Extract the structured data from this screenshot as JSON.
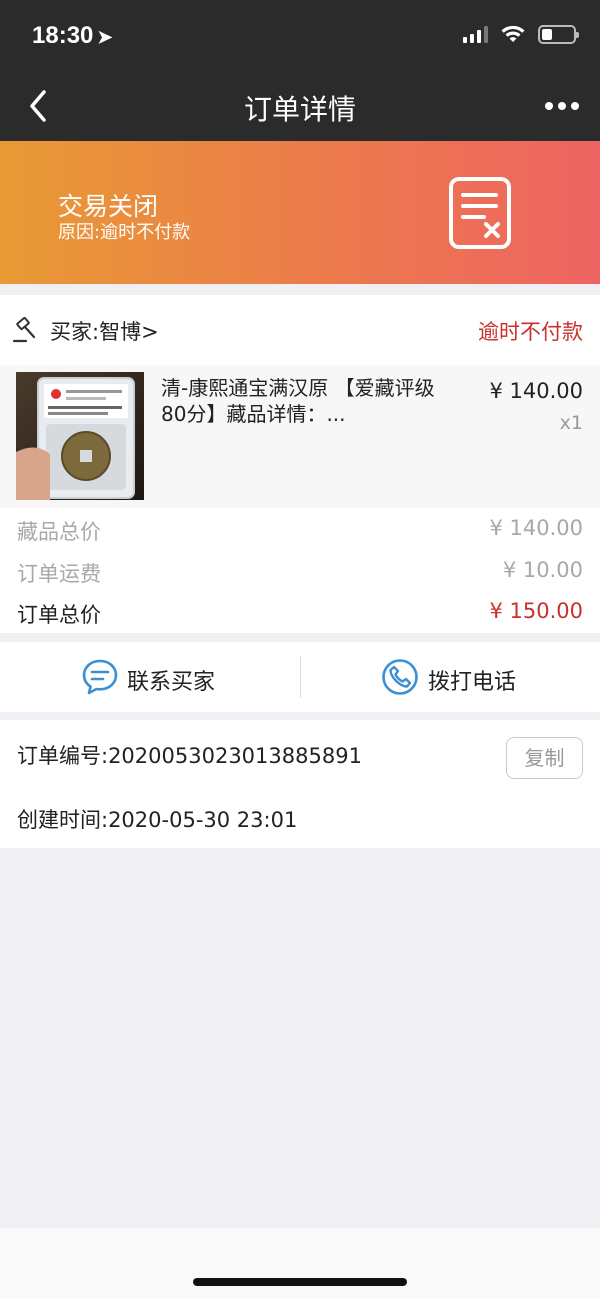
{
  "status_bar": {
    "time": "18:30",
    "location_icon": "location-arrow-icon",
    "signal_icon": "cellular-signal-icon",
    "wifi_icon": "wifi-icon",
    "battery_icon": "battery-icon"
  },
  "nav": {
    "title": "订单详情",
    "back_icon": "chevron-left-icon",
    "more_icon": "more-dots-icon"
  },
  "banner": {
    "state": "交易关闭",
    "reason": "原因:逾时不付款",
    "icon": "document-cancel-icon",
    "colors": {
      "start": "#e89a34",
      "end": "#ee6462"
    }
  },
  "buyer": {
    "icon": "auction-gavel-icon",
    "label": "买家:智博>",
    "status": "逾时不付款",
    "status_color": "#c8322e"
  },
  "product": {
    "name": "清-康熙通宝满汉原 【爱藏评级80分】藏品详情：...",
    "price": "¥ 140.00",
    "quantity": "x1"
  },
  "summary": {
    "subtotal_label": "藏品总价",
    "subtotal_value": "¥ 140.00",
    "shipping_label": "订单运费",
    "shipping_value": "¥ 10.00",
    "total_label": "订单总价",
    "total_value": "¥ 150.00"
  },
  "actions": {
    "contact_label": "联系买家",
    "contact_icon": "chat-bubble-icon",
    "call_label": "拨打电话",
    "call_icon": "phone-icon",
    "icon_color": "#3b8fd4"
  },
  "order_info": {
    "order_number": "订单编号:2020053023013885891",
    "copy_label": "复制",
    "created_time": "创建时间:2020-05-30 23:01"
  }
}
